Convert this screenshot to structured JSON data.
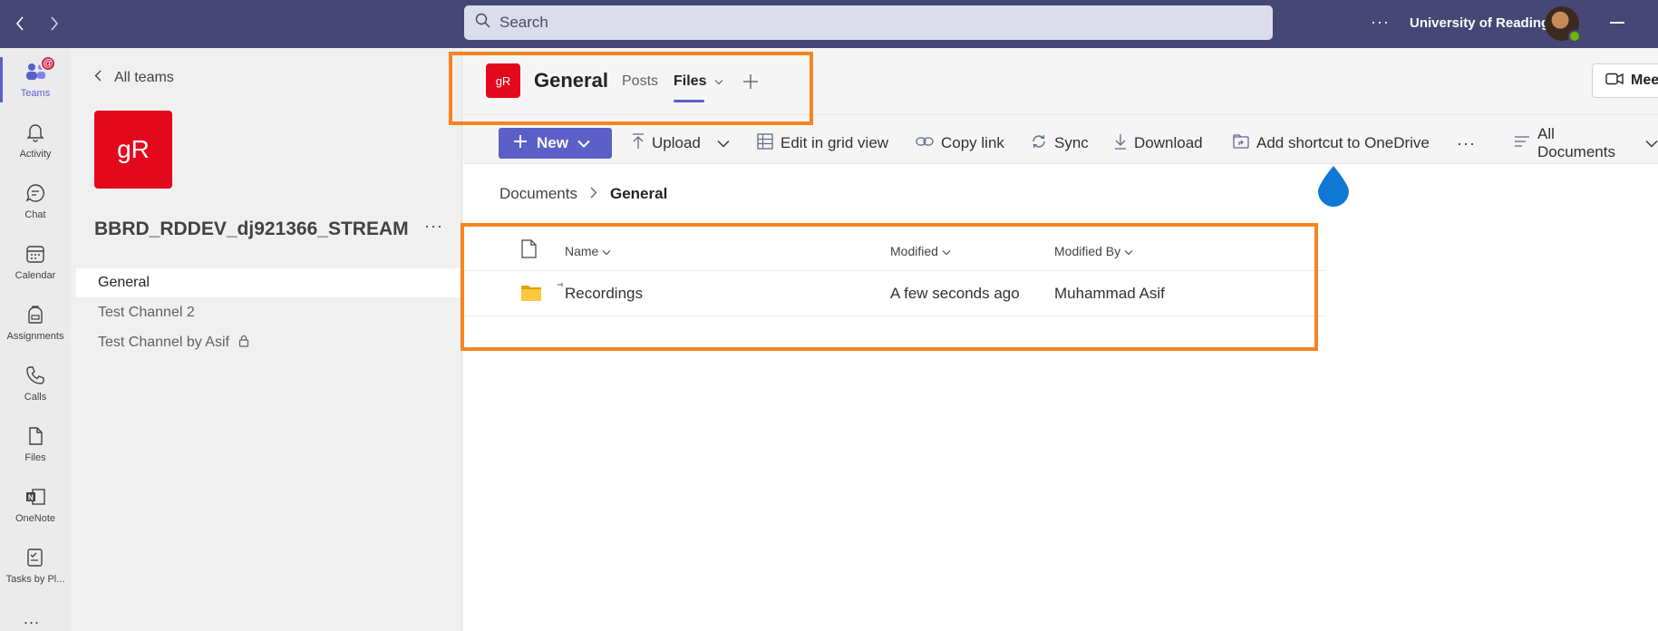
{
  "titlebar": {
    "search_placeholder": "Search",
    "org_name": "University of Reading",
    "more": "···"
  },
  "rail": {
    "items": [
      {
        "label": "Teams",
        "icon": "teams-icon",
        "badge": "@",
        "active": true
      },
      {
        "label": "Activity",
        "icon": "bell-icon"
      },
      {
        "label": "Chat",
        "icon": "chat-icon"
      },
      {
        "label": "Calendar",
        "icon": "calendar-icon"
      },
      {
        "label": "Assignments",
        "icon": "backpack-icon"
      },
      {
        "label": "Calls",
        "icon": "phone-icon"
      },
      {
        "label": "Files",
        "icon": "file-icon"
      },
      {
        "label": "OneNote",
        "icon": "onenote-icon"
      },
      {
        "label": "Tasks by Pl...",
        "icon": "tasks-icon"
      }
    ],
    "more": "..."
  },
  "team": {
    "back_label": "All teams",
    "logo_text": "gR",
    "name": "BBRD_RDDEV_dj921366_STREAM",
    "more": "···",
    "channels": [
      {
        "label": "General",
        "selected": true
      },
      {
        "label": "Test Channel 2"
      },
      {
        "label": "Test Channel by Asif",
        "private": true
      }
    ]
  },
  "channel_header": {
    "logo_text": "gR",
    "title": "General",
    "tabs": [
      {
        "label": "Posts"
      },
      {
        "label": "Files",
        "active": true
      }
    ],
    "meet_label": "Meet"
  },
  "toolbar": {
    "new_label": "New",
    "upload": "Upload",
    "grid": "Edit in grid view",
    "copy_link": "Copy link",
    "sync": "Sync",
    "download": "Download",
    "shortcut": "Add shortcut to OneDrive",
    "more": "···",
    "view": "All Documents"
  },
  "breadcrumb": {
    "root": "Documents",
    "current": "General"
  },
  "files": {
    "columns": {
      "name": "Name",
      "modified": "Modified",
      "modified_by": "Modified By"
    },
    "rows": [
      {
        "name": "Recordings",
        "modified": "A few seconds ago",
        "modified_by": "Muhammad Asif",
        "icon": "folder-icon"
      }
    ]
  },
  "colors": {
    "titlebar": "#464775",
    "accent": "#5b5fc7",
    "team_logo": "#e3091d",
    "highlight": "#f7841f"
  }
}
